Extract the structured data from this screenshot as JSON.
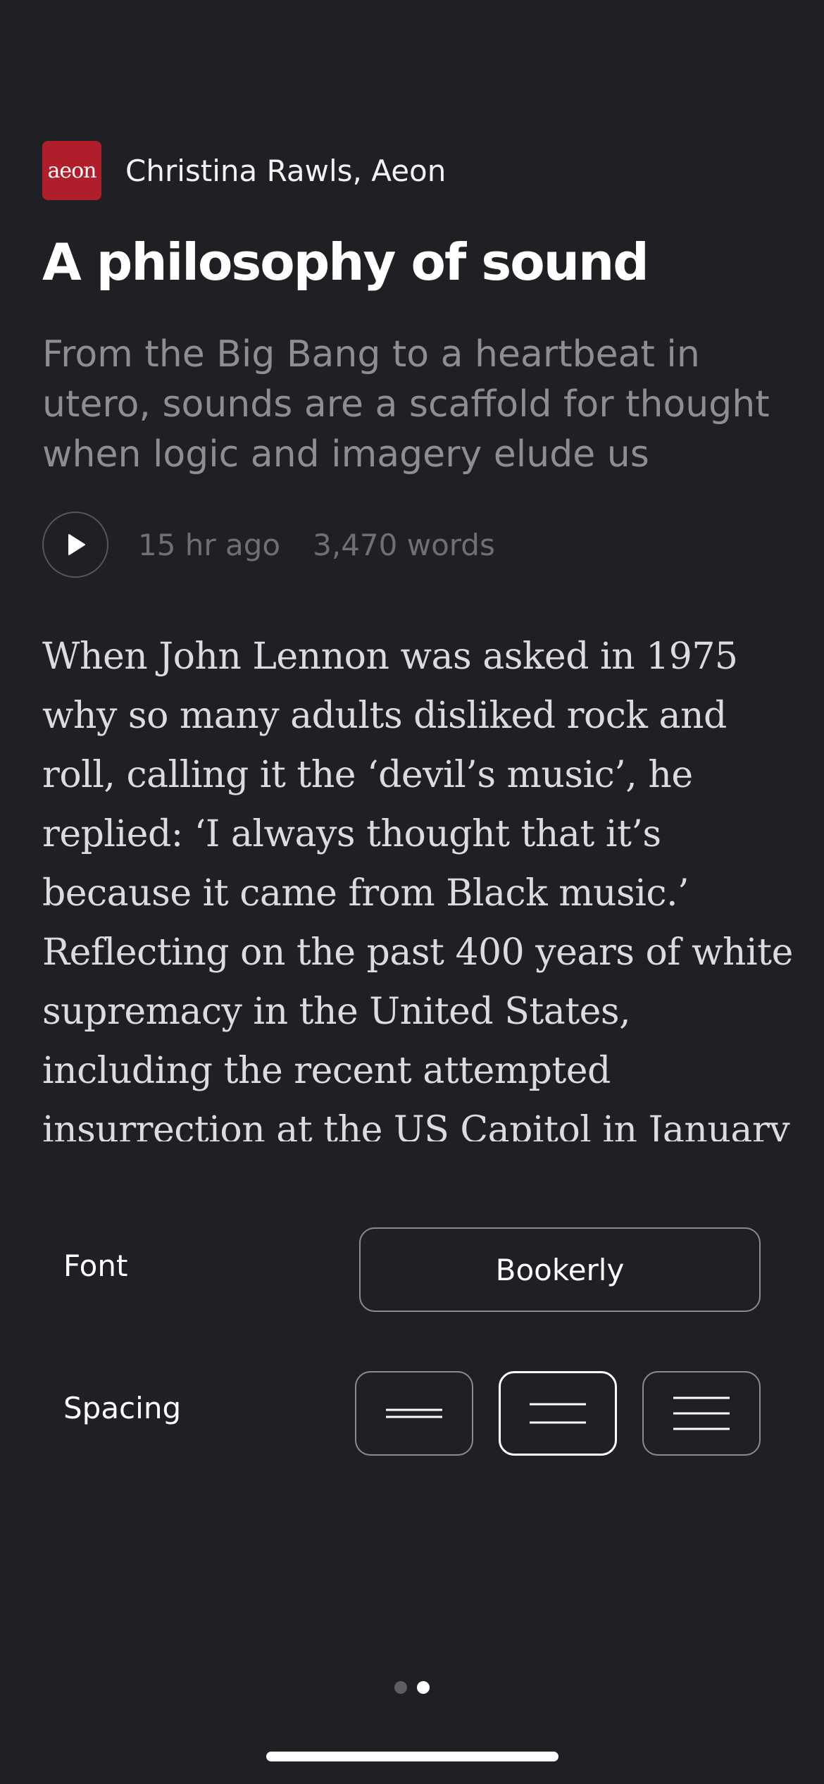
{
  "article": {
    "source_logo_text": "aeon",
    "byline": "Christina Rawls, Aeon",
    "title": "A philosophy of sound",
    "subtitle": "From the Big Bang to a heartbeat in utero, sounds are a scaffold for thought when logic and imagery elude us",
    "time_ago": "15 hr ago",
    "word_count": "3,470 words",
    "body": "When John Lennon was asked in 1975 why so many adults disliked rock and roll, calling it the ‘devil’s music’, he replied: ‘I always thought that it’s because it came from Black music.’ Reflecting on the past 400 years of white supremacy in the United States, including the recent attempted insurrection at the US Capitol in January"
  },
  "settings": {
    "font_label": "Font",
    "font_value": "Bookerly",
    "spacing_label": "Spacing",
    "spacing_options": [
      "compact",
      "normal",
      "wide"
    ],
    "spacing_selected": "normal"
  },
  "pager": {
    "page_count": 2,
    "current_page": 2
  },
  "colors": {
    "background": "#1f2024",
    "source_logo": "#b01e2b",
    "subtitle": "#8d8e93",
    "meta": "#6f7075"
  },
  "icons": {
    "play": "play-icon",
    "spacing": "spacing-lines-icon"
  }
}
